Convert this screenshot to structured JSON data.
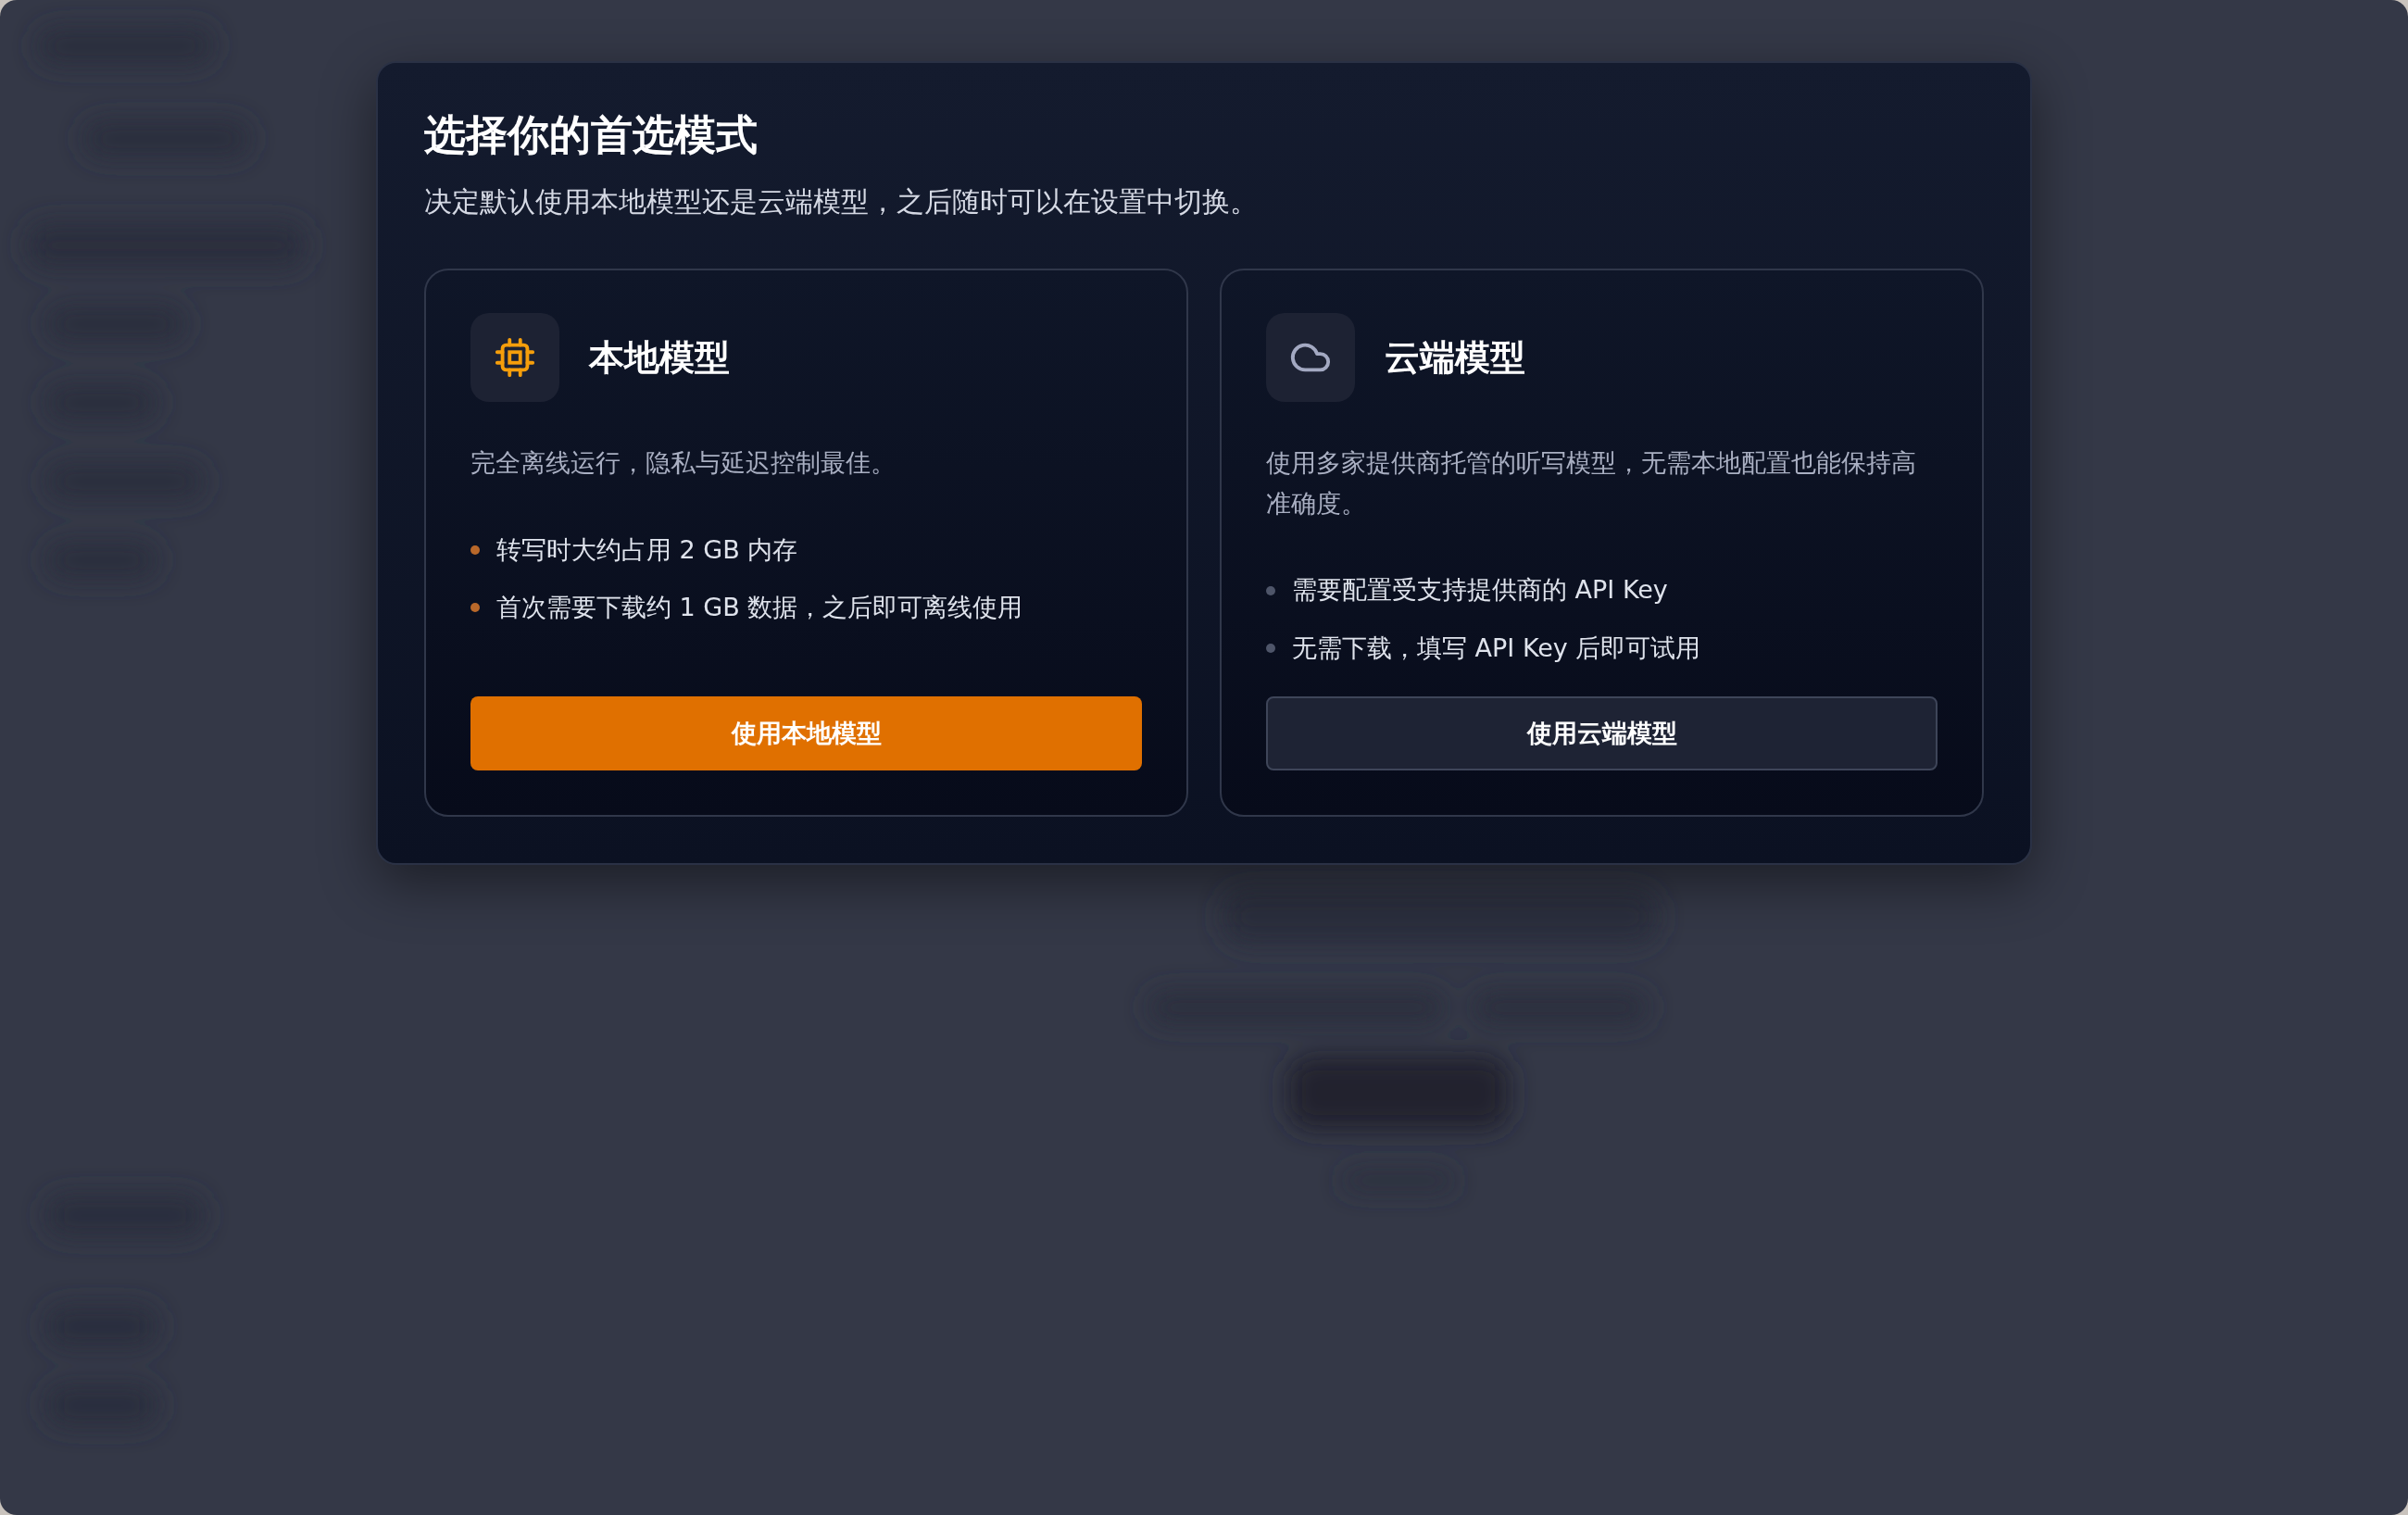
{
  "dialog": {
    "title": "选择你的首选模式",
    "subtitle": "决定默认使用本地模型还是云端模型，之后随时可以在设置中切换。",
    "options": [
      {
        "kind": "local",
        "title": "本地模型",
        "description": "完全离线运行，隐私与延迟控制最佳。",
        "bullets": [
          "转写时大约占用 2 GB 内存",
          "首次需要下载约 1 GB 数据，之后即可离线使用"
        ],
        "button": "使用本地模型"
      },
      {
        "kind": "cloud",
        "title": "云端模型",
        "description": "使用多家提供商托管的听写模型，无需本地配置也能保持高准确度。",
        "bullets": [
          "需要配置受支持提供商的 API Key",
          "无需下载，填写 API Key 后即可试用"
        ],
        "button": "使用云端模型"
      }
    ]
  }
}
